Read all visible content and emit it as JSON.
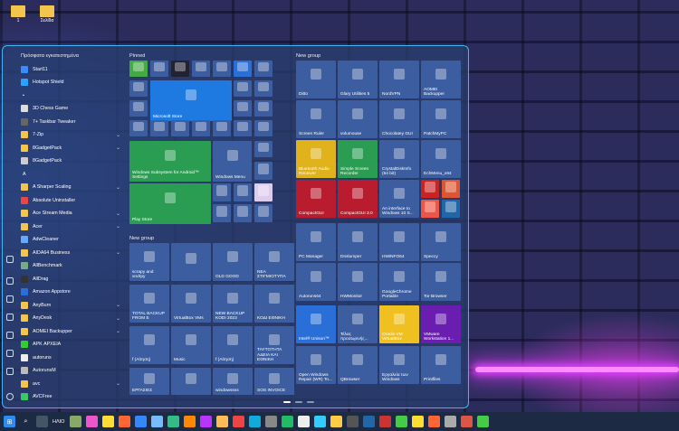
{
  "desktop": {
    "icons": [
      {
        "label": "1"
      },
      {
        "label": "Σελίδα"
      }
    ]
  },
  "start": {
    "user": "Πρόσφατα εγκατεστημένα",
    "recent": [
      "Start11",
      "Hotspot Shield"
    ],
    "apps": [
      "3D Chess Game",
      "7+ Taskbar Tweaker",
      "7-Zip",
      "8GadgetPack",
      "8GadgetPack",
      "A",
      "A Sharper Scaling",
      "Absolute Uninstaller",
      "Ace Stream Media",
      "Acer",
      "AdwCleaner",
      "AIDA64 Business",
      "AllBenchmark",
      "AllDrag",
      "Amazon Appstore",
      "AnyBurn",
      "AnyDesk",
      "AOMEI Backupper",
      "APK ΑΡΧΕΙΑ",
      "autoruns",
      "AutorunsM",
      "avc",
      "AVCFree"
    ],
    "pinned_title": "Pinned",
    "newgroup_title": "New group",
    "newgroup2_title": "New group",
    "tiles": {
      "ms_store": "Microsoft Store",
      "wsa": "Windows Subsystem for Android™ Settings",
      "windows_menu": "Windows Menu",
      "play_store": "Play Store",
      "ditto": "Ditto",
      "glary": "Glary Utilities 5",
      "nordvpn": "NordVPN",
      "aomei": "AOMEI Backupper",
      "screen_ruler": "Screen Ruler",
      "volumouse": "volumouse",
      "chocolatey": "Chocolatey GUI",
      "patchmypc": "PatchMyPC",
      "bluetooth": "Bluetooth Audio Receiver",
      "ssr": "Simple Screen Recorder",
      "crystal": "CrystalDiskInfo (64 bit)",
      "echomo": "EchMenu_x64",
      "compactgui": "CompactGUI",
      "compactgui3": "CompactGUI 3.0",
      "interface": "An interface to Windows 10 S...",
      "pcmanager": "PC Manager",
      "dnslumper": "Dnslumper",
      "hwinfo": "HWiNFO64",
      "speccy": "Speccy",
      "autoruns64": "Autoruns64",
      "hwmonitor": "HWMonitor",
      "chrome": "GoogleChrome Portable",
      "tor": "Tor Browser",
      "unison": "Intel® Unison™",
      "tools": "Τέλος προσωρινής...",
      "oracle": "Oracle VM VirtualBox",
      "vmware": "VMware Workstation 1...",
      "openwindows": "Open Windows Repair (WR) To...",
      "qbrowser": "QBrowser",
      "tools2": "Εργαλεία των Windows",
      "printfiles": "Printfiles",
      "scrap": "scrapy and xndrpy",
      "old": "OLD GOOD",
      "nea": "NEA ΣΤΙΓΜΙΟΤΥΠΑ",
      "total": "TOTAL BACKUP FROM E",
      "vbvms": "VirtualBox VMs",
      "newbackup": "NEW BACKUP KODI 2023",
      "kodi": "ΚΟΔΙ ΕΘΝΙΚΗ",
      "aitisi": "f (Αίτηση)",
      "music": "Music",
      "aitisi2": "f (Αίτηση)",
      "taytotita": "ΤΑΥΤΟΤΗΤΑ ΑΔΕΙΑ ΚΑΙ ΕΘΝΙΚΗ",
      "ergasies": "ΕΡΓΑΣΙΕΣ",
      "win": "windowssss",
      "invoice": "SOS INVOICE"
    }
  },
  "taskbar": {
    "label": "ΗΛΙΟ"
  }
}
